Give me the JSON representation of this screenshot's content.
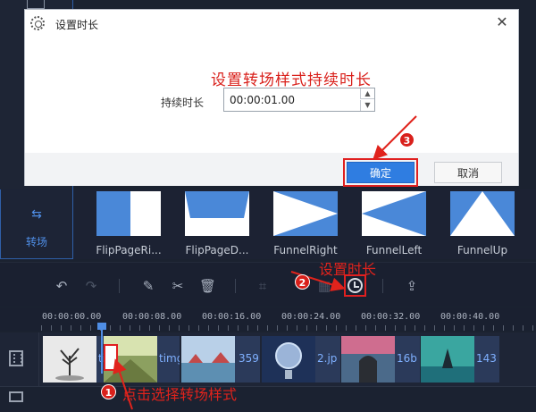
{
  "dialog": {
    "title": "设置时长",
    "close_glyph": "✕",
    "heading": "设置转场样式持续时长",
    "duration_label": "持续时长",
    "duration_value": "00:00:01.00",
    "ok_label": "确定",
    "cancel_label": "取消"
  },
  "transitions": {
    "selected_label": "转场",
    "items": [
      "FlipPageRi...",
      "FlipPageD...",
      "FunnelRight",
      "FunnelLeft",
      "FunnelUp"
    ]
  },
  "toolbar": {
    "icons": [
      "undo-icon",
      "redo-icon",
      "pencil-icon",
      "scissors-icon",
      "trash-icon",
      "crop-icon",
      "mosaic-icon",
      "clock-icon",
      "export-icon"
    ]
  },
  "timeline": {
    "ruler": [
      "00:00:00.00",
      "00:00:08.00",
      "00:00:16.00",
      "00:00:24.00",
      "00:00:32.00",
      "00:00:40.00"
    ],
    "clips": [
      "tim",
      "timg",
      "359",
      "2.jp",
      "16b",
      "143"
    ]
  },
  "annotations": {
    "badge1": "1",
    "badge2": "2",
    "badge3": "3",
    "step1_text": "点击选择转场样式",
    "step2_text": "设置时长"
  },
  "colors": {
    "accent": "#2f7de1",
    "annotation_red": "#e0231c",
    "background": "#1b2230"
  }
}
